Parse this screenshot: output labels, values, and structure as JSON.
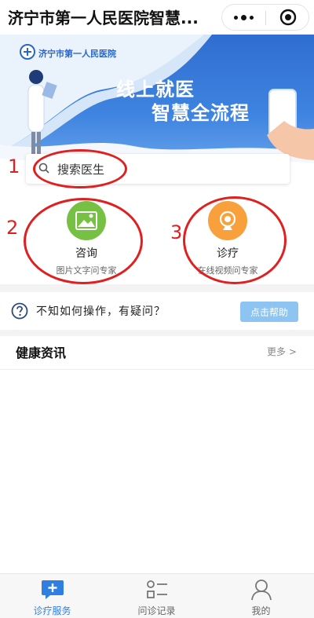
{
  "header": {
    "title": "济宁市第一人民医院智慧...",
    "more_icon": "more-dots-icon",
    "close_icon": "target-circle-icon"
  },
  "banner": {
    "logo_text": "济宁市第一人民医院",
    "slogan_line1": "线上就医",
    "slogan_line2": "智慧全流程"
  },
  "search": {
    "placeholder": "搜索医生",
    "icon": "search-icon"
  },
  "services": [
    {
      "name": "咨询",
      "desc": "图片文字问专家",
      "icon": "image-icon",
      "color": "#76c043"
    },
    {
      "name": "诊疗",
      "desc": "在线视频问专家",
      "icon": "camera-icon",
      "color": "#f8a03b"
    }
  ],
  "help": {
    "text": "不知如何操作，有疑问？",
    "button": "点击帮助"
  },
  "news": {
    "title": "健康资讯",
    "more": "更多 >"
  },
  "tabbar": [
    {
      "label": "诊疗服务",
      "icon": "chat-plus-icon",
      "active": true
    },
    {
      "label": "问诊记录",
      "icon": "list-icon",
      "active": false
    },
    {
      "label": "我的",
      "icon": "user-icon",
      "active": false
    }
  ],
  "annotations": [
    "1",
    "2",
    "3"
  ],
  "colors": {
    "accent": "#2f7fe0",
    "annotation_red": "#e02020",
    "help_button": "#8dc4f2"
  }
}
